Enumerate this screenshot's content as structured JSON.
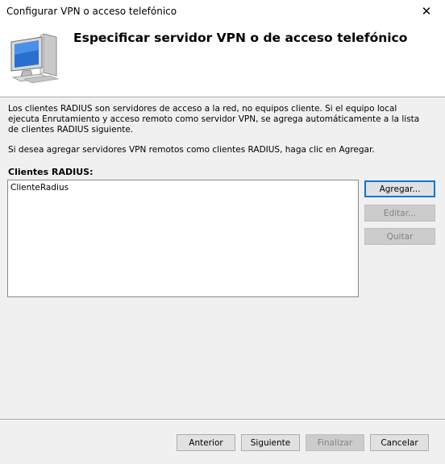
{
  "window": {
    "title": "Configurar VPN o acceso telefónico",
    "close_icon": "✕"
  },
  "header": {
    "title": "Especificar servidor VPN o de acceso telefónico",
    "icon": "computer-monitor-icon"
  },
  "main": {
    "description": "Los clientes RADIUS son servidores de acceso a la red, no equipos cliente. Si el equipo local ejecuta Enrutamiento y acceso remoto como servidor VPN, se agrega automáticamente a la lista de clientes RADIUS siguiente.",
    "instruction": "Si desea agregar servidores VPN remotos como clientes RADIUS, haga clic en Agregar.",
    "list_label": "Clientes RADIUS:",
    "clients": [
      "ClienteRadius"
    ],
    "buttons": {
      "add": "Agregar...",
      "edit": "Editar...",
      "remove": "Quitar"
    }
  },
  "footer": {
    "back": "Anterior",
    "next": "Siguiente",
    "finish": "Finalizar",
    "cancel": "Cancelar"
  },
  "colors": {
    "accent": "#0078d7",
    "background": "#f0f0f0",
    "panel": "#ffffff"
  }
}
